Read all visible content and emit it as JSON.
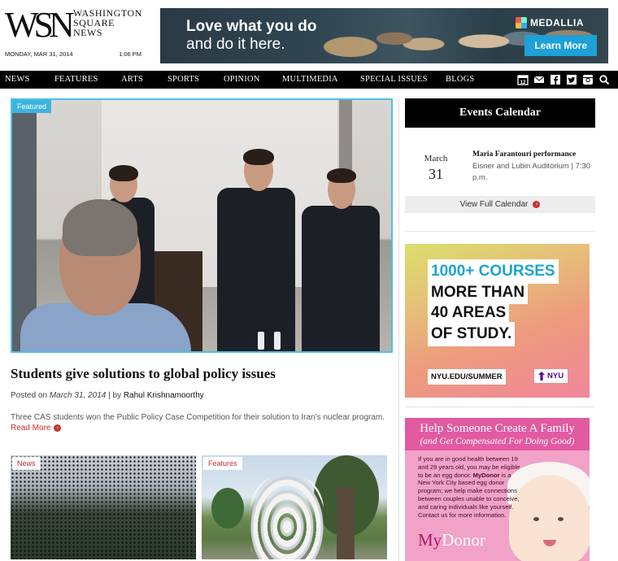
{
  "header": {
    "logo_mark": "WSN",
    "logo_lines": [
      "WASHINGTON",
      "SQUARE",
      "NEWS"
    ],
    "date": "MONDAY, MAR 31, 2014",
    "time": "1:06 PM"
  },
  "top_ad": {
    "line1": "Love what you do",
    "line2": "and do it here.",
    "brand": "MEDALLIA",
    "button": "Learn More"
  },
  "nav": {
    "items": [
      "NEWS",
      "FEATURES",
      "ARTS",
      "SPORTS",
      "OPINION",
      "MULTIMEDIA",
      "SPECIAL ISSUES",
      "BLOGS"
    ],
    "icons": [
      "calendar-icon",
      "mail-icon",
      "facebook-icon",
      "twitter-icon",
      "instagram-icon",
      "search-icon"
    ],
    "calendar_number": "12"
  },
  "featured": {
    "badge": "Featured",
    "title": "Students give solutions to global policy issues",
    "posted_prefix": "Posted on",
    "date": "March 31, 2014",
    "by": "| by",
    "author": "Rahul Krishnamoorthy",
    "excerpt": "Three CAS students won the Public Policy Case Competition for their solution to Iran’s nuclear program.",
    "read_more": "Read More"
  },
  "thumbnails": [
    {
      "category": "News"
    },
    {
      "category": "Features"
    }
  ],
  "events": {
    "heading": "Events Calendar",
    "month": "March",
    "day": "31",
    "title": "Maria Farantouri performance",
    "location": "Eisner and Lubin Auditorium | 7:30 p.m.",
    "view_all": "View Full Calendar"
  },
  "nyu_ad": {
    "line1": "1000+ COURSES",
    "line2": "MORE THAN",
    "line3": "40 AREAS",
    "line4": "OF STUDY.",
    "url": "NYU.EDU/SUMMER",
    "logo": "NYU"
  },
  "donor_ad": {
    "headline": "Help Someone Create A Family",
    "subhead": "(and Get Compensated For Doing Good)",
    "body_intro": "If you are in good health between 19 and 29 years old, you may be eligible to be an egg donor.",
    "brand_bold": "MyDonor",
    "body_rest": "is a New York City based egg donor program; we help make connections between couples unable to conceive, and caring individuals like yourself. Contact us for more information.",
    "logo_my": "My",
    "logo_donor": "Donor"
  },
  "colors": {
    "featured_border": "#4fbfe5",
    "accent_red": "#c8312b",
    "nav_bg": "#000000",
    "ad_blue": "#1ea0d8",
    "nyu_purple": "#57068c",
    "donor_pink": "#e25aa0"
  }
}
